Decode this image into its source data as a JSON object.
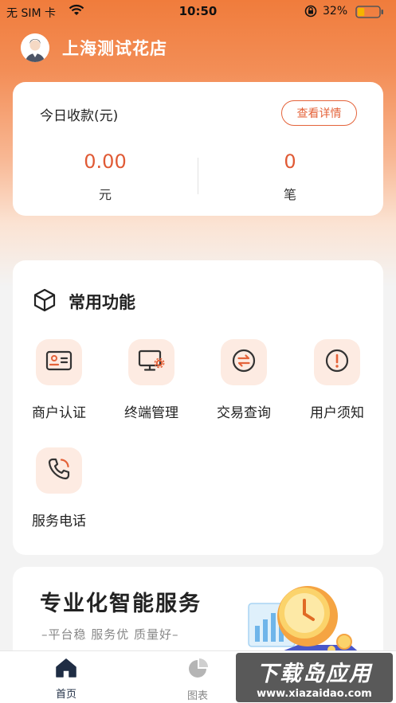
{
  "status_bar": {
    "carrier": "无 SIM 卡",
    "time": "10:50",
    "battery": "32%",
    "battery_level": 0.32
  },
  "header": {
    "store_name": "上海测试花店"
  },
  "today": {
    "title": "今日收款(元)",
    "detail_button": "查看详情",
    "amount": "0.00",
    "amount_unit": "元",
    "count": "0",
    "count_unit": "笔"
  },
  "functions": {
    "title": "常用功能",
    "items": [
      {
        "label": "商户认证",
        "icon": "id-card-icon"
      },
      {
        "label": "终端管理",
        "icon": "monitor-settings-icon"
      },
      {
        "label": "交易查询",
        "icon": "exchange-icon"
      },
      {
        "label": "用户须知",
        "icon": "exclamation-icon"
      },
      {
        "label": "服务电话",
        "icon": "phone-icon"
      }
    ]
  },
  "promo": {
    "title": "专业化智能服务",
    "subtitle": "–平台稳  服务优  质量好–"
  },
  "tab_bar": {
    "tabs": [
      {
        "label": "首页",
        "active": true
      },
      {
        "label": "图表",
        "active": false
      }
    ]
  },
  "watermark": {
    "main": "下载岛应用",
    "sub": "www.xiazaidao.com"
  },
  "colors": {
    "accent": "#e4633a",
    "value": "#e05a35",
    "icon_bg": "#fdebe2",
    "tab_active": "#1f2d44",
    "tab_inactive": "#aaaaaa"
  }
}
